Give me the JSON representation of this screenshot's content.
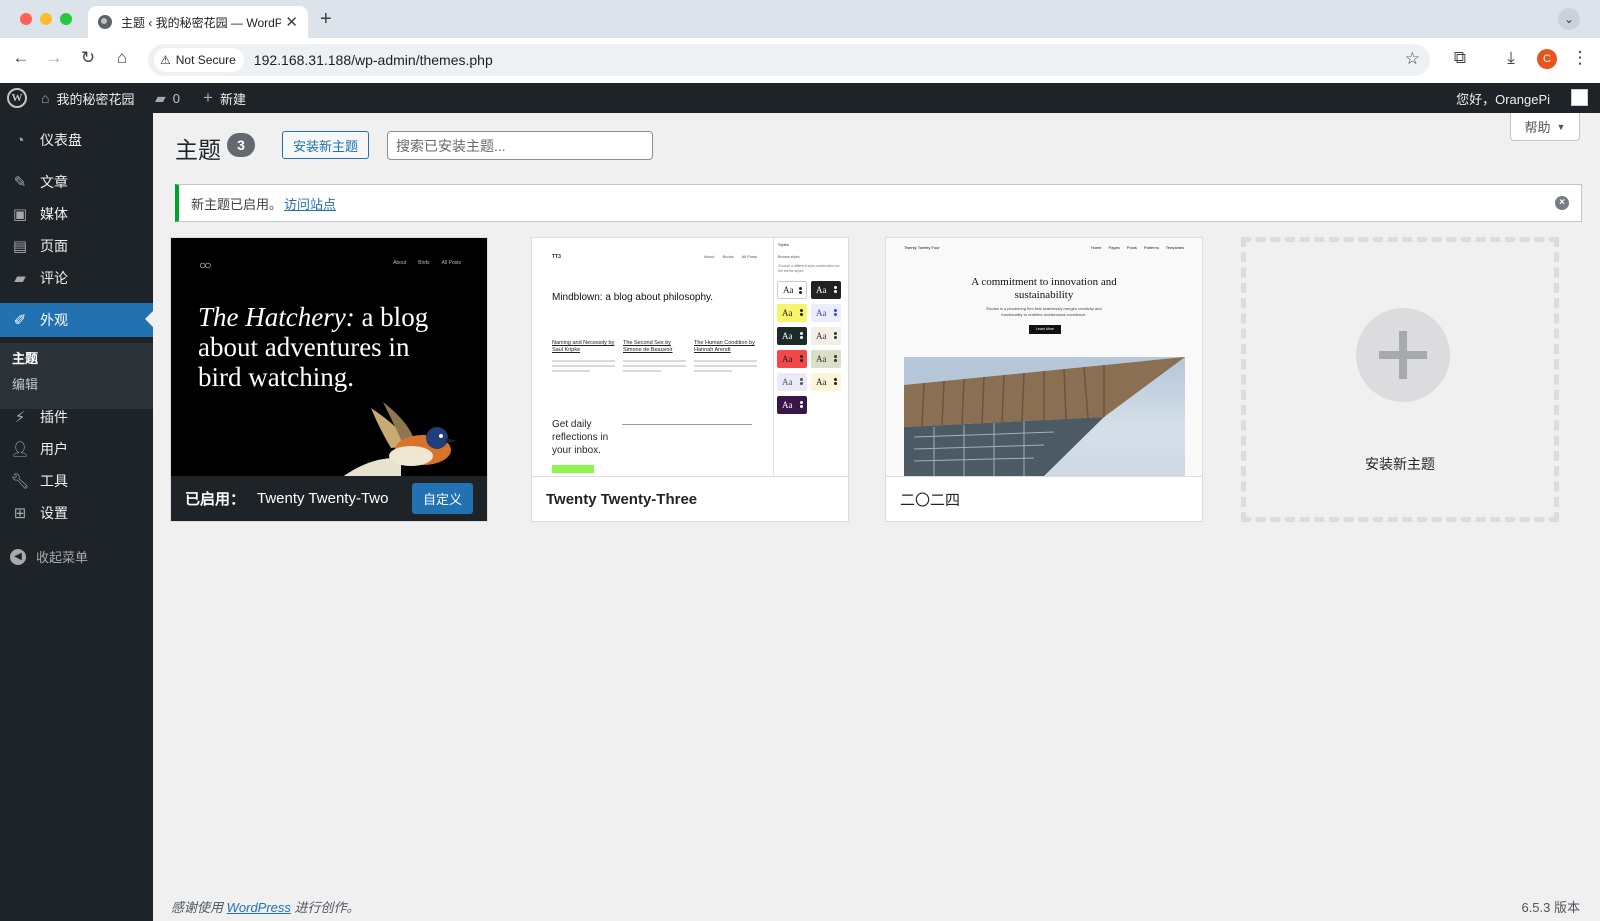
{
  "browser": {
    "tab_title": "主题 ‹ 我的秘密花园 — WordPress",
    "security_label": "Not Secure",
    "url": "192.168.31.188/wp-admin/themes.php",
    "profile_initial": "C"
  },
  "adminbar": {
    "site_name": "我的秘密花园",
    "comments_count": "0",
    "new_label": "新建",
    "greeting": "您好，OrangePi"
  },
  "sidebar": {
    "items": [
      {
        "label": "仪表盘",
        "icon": "dashboard-icon"
      },
      {
        "label": "文章",
        "icon": "pin-icon"
      },
      {
        "label": "媒体",
        "icon": "media-icon"
      },
      {
        "label": "页面",
        "icon": "page-icon"
      },
      {
        "label": "评论",
        "icon": "comment-icon"
      },
      {
        "label": "外观",
        "icon": "brush-icon"
      },
      {
        "label": "插件",
        "icon": "plugin-icon"
      },
      {
        "label": "用户",
        "icon": "user-icon"
      },
      {
        "label": "工具",
        "icon": "wrench-icon"
      },
      {
        "label": "设置",
        "icon": "settings-icon"
      }
    ],
    "submenu": [
      {
        "label": "主题"
      },
      {
        "label": "编辑"
      }
    ],
    "collapse_label": "收起菜单"
  },
  "main": {
    "help_label": "帮助",
    "title": "主题",
    "count": "3",
    "add_new_label": "安装新主题",
    "search_placeholder": "搜索已安装主题...",
    "notice_text": "新主题已启用。",
    "notice_link": "访问站点",
    "themes": [
      {
        "name": "Twenty Twenty-Two",
        "active_label": "已启用：",
        "customize_label": "自定义",
        "shot": {
          "nav": [
            "About",
            "Birds",
            "All Posts"
          ],
          "headline_italic": "The Hatchery:",
          "headline_rest": " a blog about adventures in bird watching."
        }
      },
      {
        "name": "Twenty Twenty-Three",
        "shot": {
          "brand": "TT3",
          "nav": [
            "About",
            "Books",
            "All Posts"
          ],
          "tagline": "Mindblown: a blog about philosophy.",
          "posts": [
            "Naming and Necessity by Saul Kripke",
            "The Second Sex by Simone de Beauvoir",
            "The Human Condition by Hannah Arendt"
          ],
          "cta": "Get daily reflections in your inbox.",
          "styles_header": "Styles",
          "browse_styles": "Browse styles",
          "styles_desc": "Choose a different style combination for the theme styles",
          "swatch_text": "Aa"
        }
      },
      {
        "name": "二〇二四",
        "shot": {
          "brand": "Twenty Twenty Four",
          "nav": [
            "Home",
            "Pages",
            "Posts",
            "Patterns",
            "Templates"
          ],
          "headline": "A commitment to innovation and sustainability",
          "sub": "Études is a pioneering firm that seamlessly merges creativity and functionality to redefine architectural excellence.",
          "button": "Learn More"
        }
      }
    ],
    "add_card_label": "安装新主题"
  },
  "footer": {
    "thanks_pre": "感谢使用 ",
    "thanks_link": "WordPress",
    "thanks_post": " 进行创作。",
    "version": "6.5.3 版本"
  },
  "colors": {
    "accent": "#2271b1",
    "admin_dark": "#1d2327",
    "notice_success": "#00a32a"
  }
}
